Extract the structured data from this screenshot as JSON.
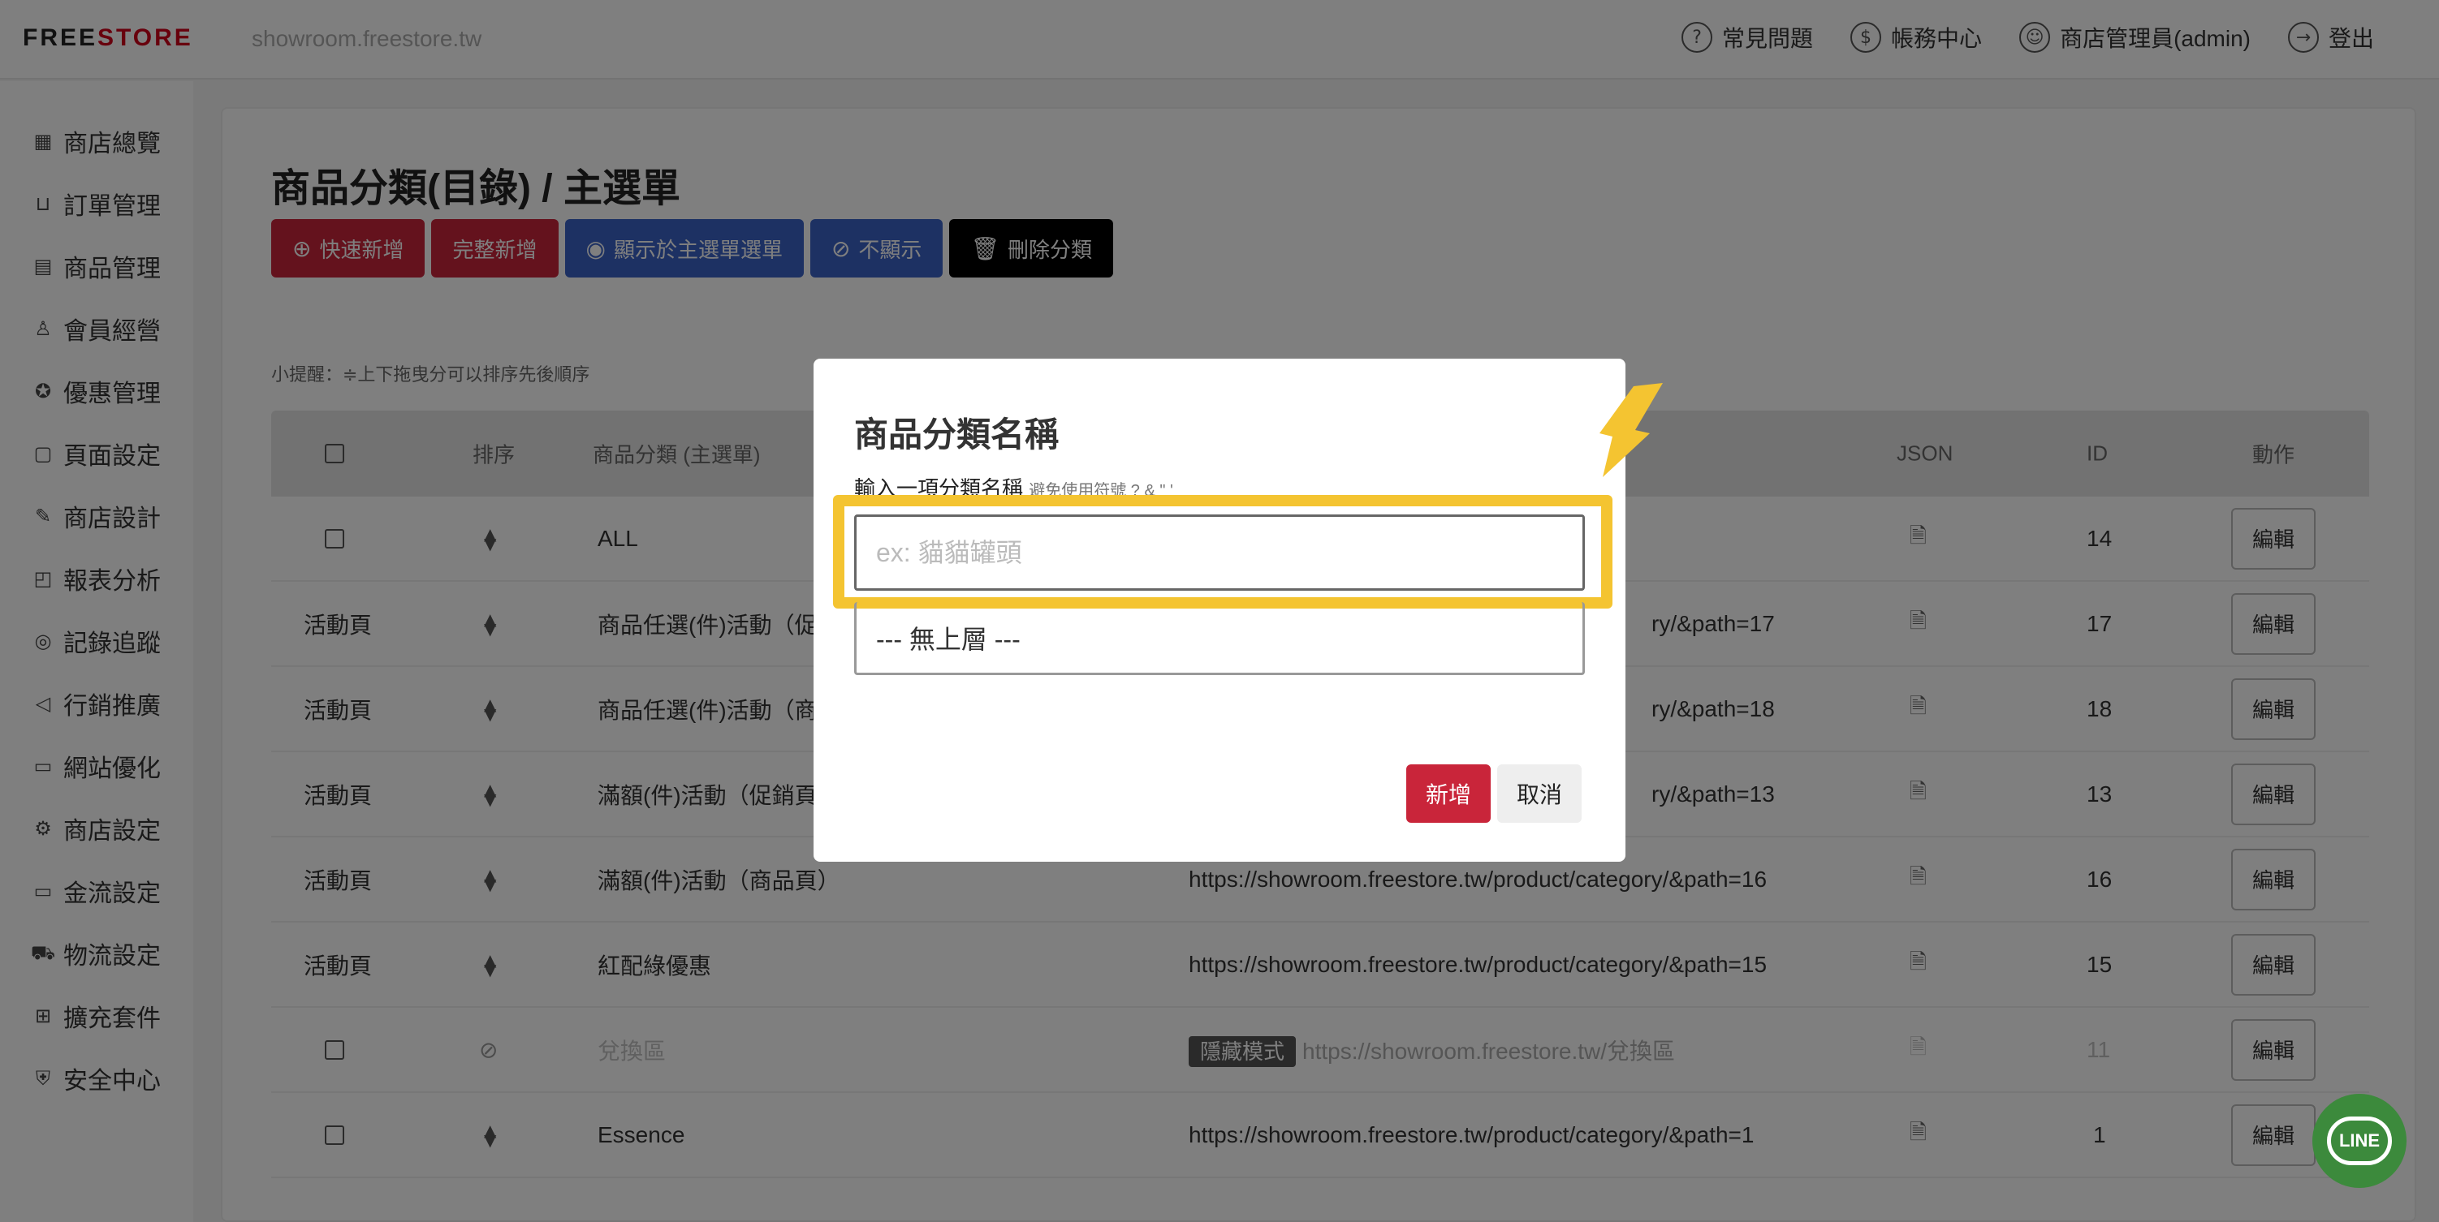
{
  "header": {
    "logo_prefix": "FREE",
    "logo_suffix": "STORE",
    "domain": "showroom.freestore.tw",
    "nav": [
      {
        "label": "常見問題",
        "icon": "question-icon"
      },
      {
        "label": "帳務中心",
        "icon": "dollar-icon"
      },
      {
        "label": "商店管理員(admin)",
        "icon": "user-icon"
      },
      {
        "label": "登出",
        "icon": "logout-icon"
      }
    ]
  },
  "sidebar": {
    "items": [
      {
        "label": "商店總覽",
        "icon": "grid-icon"
      },
      {
        "label": "訂單管理",
        "icon": "basket-icon"
      },
      {
        "label": "商品管理",
        "icon": "clipboard-icon"
      },
      {
        "label": "會員經營",
        "icon": "person-icon"
      },
      {
        "label": "優惠管理",
        "icon": "badge-icon"
      },
      {
        "label": "頁面設定",
        "icon": "page-icon"
      },
      {
        "label": "商店設計",
        "icon": "brush-icon"
      },
      {
        "label": "報表分析",
        "icon": "chart-icon"
      },
      {
        "label": "記錄追蹤",
        "icon": "target-icon"
      },
      {
        "label": "行銷推廣",
        "icon": "megaphone-icon"
      },
      {
        "label": "網站優化",
        "icon": "monitor-icon"
      },
      {
        "label": "商店設定",
        "icon": "gear-icon"
      },
      {
        "label": "金流設定",
        "icon": "card-icon"
      },
      {
        "label": "物流設定",
        "icon": "truck-icon"
      },
      {
        "label": "擴充套件",
        "icon": "puzzle-icon"
      },
      {
        "label": "安全中心",
        "icon": "shield-icon"
      }
    ]
  },
  "main": {
    "title": "商品分類(目錄) / 主選單",
    "actions": {
      "quick_add": "快速新增",
      "full_add": "完整新增",
      "show_in_menu": "顯示於主選單選單",
      "hide": "不顯示",
      "delete": "刪除分類"
    },
    "tip": "小提醒：≑上下拖曳分可以排序先後順序",
    "table": {
      "headers": {
        "sort": "排序",
        "category": "商品分類 (主選單)",
        "json": "JSON",
        "id": "ID",
        "action": "動作"
      },
      "edit_label": "編輯",
      "hidden_badge": "隱藏模式",
      "rows": [
        {
          "type": "ALL",
          "name": "ALL",
          "url": "",
          "id": "14"
        },
        {
          "type": "活動頁",
          "name": "商品任選(件)活動（促",
          "url": "ry/&path=17",
          "id": "17"
        },
        {
          "type": "活動頁",
          "name": "商品任選(件)活動（商",
          "url": "ry/&path=18",
          "id": "18"
        },
        {
          "type": "活動頁",
          "name": "滿額(件)活動（促銷頁",
          "url": "ry/&path=13",
          "id": "13"
        },
        {
          "type": "活動頁",
          "name": "滿額(件)活動（商品頁）",
          "url": "https://showroom.freestore.tw/product/category/&path=16",
          "id": "16"
        },
        {
          "type": "活動頁",
          "name": "紅配綠優惠",
          "url": "https://showroom.freestore.tw/product/category/&path=15",
          "id": "15"
        },
        {
          "type": "",
          "name": "兌換區",
          "url": "https://showroom.freestore.tw/兌換區",
          "id": "11"
        },
        {
          "type": "",
          "name": "Essence",
          "url": "https://showroom.freestore.tw/product/category/&path=1",
          "id": "1"
        }
      ]
    }
  },
  "modal": {
    "title": "商品分類名稱",
    "label": "輸入一項分類名稱",
    "hint": "避免使用符號 ? & \" '",
    "input_placeholder": "ex: 貓貓罐頭",
    "parent_option": "--- 無上層 ---",
    "add_label": "新增",
    "cancel_label": "取消"
  },
  "line_label": "LINE",
  "colors": {
    "brand_red": "#c9253a",
    "blue": "#3b63c7",
    "highlight": "#f4c431",
    "line_green": "#3c8a3c"
  }
}
